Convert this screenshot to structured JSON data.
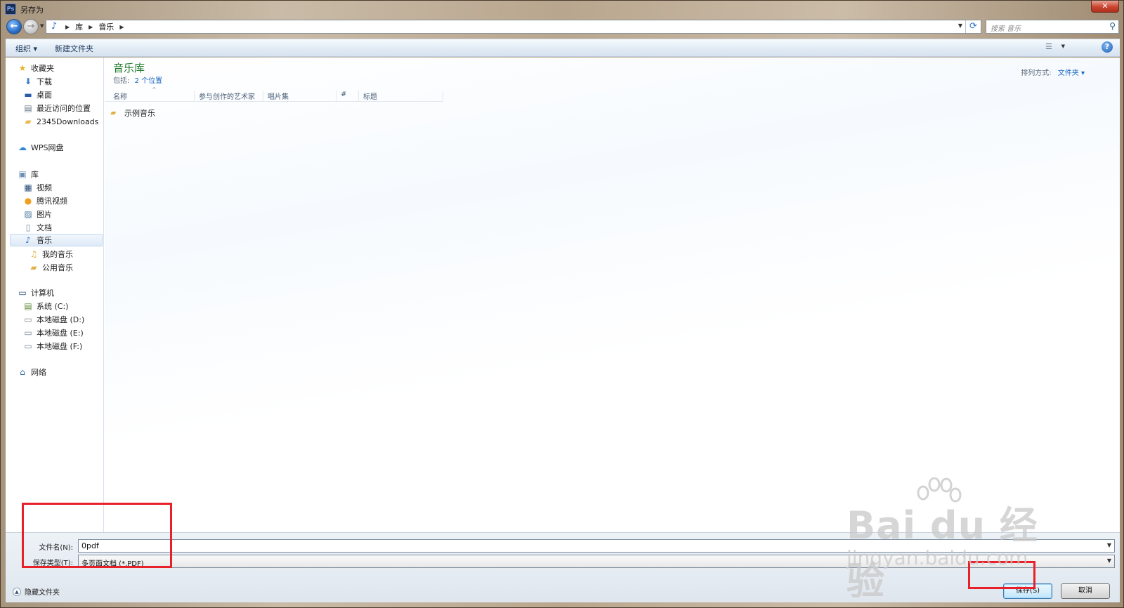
{
  "window": {
    "title": "另存为",
    "app_icon": "Ps",
    "close_glyph": "✕"
  },
  "nav": {
    "back_glyph": "←",
    "forward_glyph": "→",
    "breadcrumbs": [
      "库",
      "音乐"
    ],
    "search_placeholder": "搜索 音乐"
  },
  "toolbar": {
    "organize": "组织 ▾",
    "new_folder": "新建文件夹",
    "help": "?"
  },
  "sidebar": {
    "favorites": "收藏夹",
    "downloads": "下载",
    "desktop": "桌面",
    "recent": "最近访问的位置",
    "downloads2345": "2345Downloads",
    "wps": "WPS网盘",
    "libraries": "库",
    "videos": "视频",
    "tencent_video": "腾讯视频",
    "pictures": "图片",
    "documents": "文档",
    "music": "音乐",
    "my_music": "我的音乐",
    "public_music": "公用音乐",
    "computer": "计算机",
    "drive_c": "系统 (C:)",
    "drive_d": "本地磁盘 (D:)",
    "drive_e": "本地磁盘 (E:)",
    "drive_f": "本地磁盘 (F:)",
    "network": "网络"
  },
  "main": {
    "library_title": "音乐库",
    "includes_label": "包括:",
    "includes_link": "2 个位置",
    "arrange_label": "排列方式:",
    "arrange_value": "文件夹 ▾",
    "columns": [
      "名称",
      "参与创作的艺术家",
      "唱片集",
      "#",
      "标题"
    ],
    "files": [
      "示例音乐"
    ]
  },
  "bottom": {
    "filename_label": "文件名(N):",
    "filename_value": "0pdf",
    "filetype_label": "保存类型(T):",
    "filetype_value": "多页面文档 (*.PDF)",
    "hide_folders": "隐藏文件夹",
    "save": "保存(S)",
    "cancel": "取消"
  },
  "watermark": {
    "main": "Bai du 经验",
    "sub": "jingyan.baidu.com"
  },
  "colors": {
    "library_title": "#1f7a2a",
    "link": "#1565c0",
    "annotation": "#e8202a"
  }
}
